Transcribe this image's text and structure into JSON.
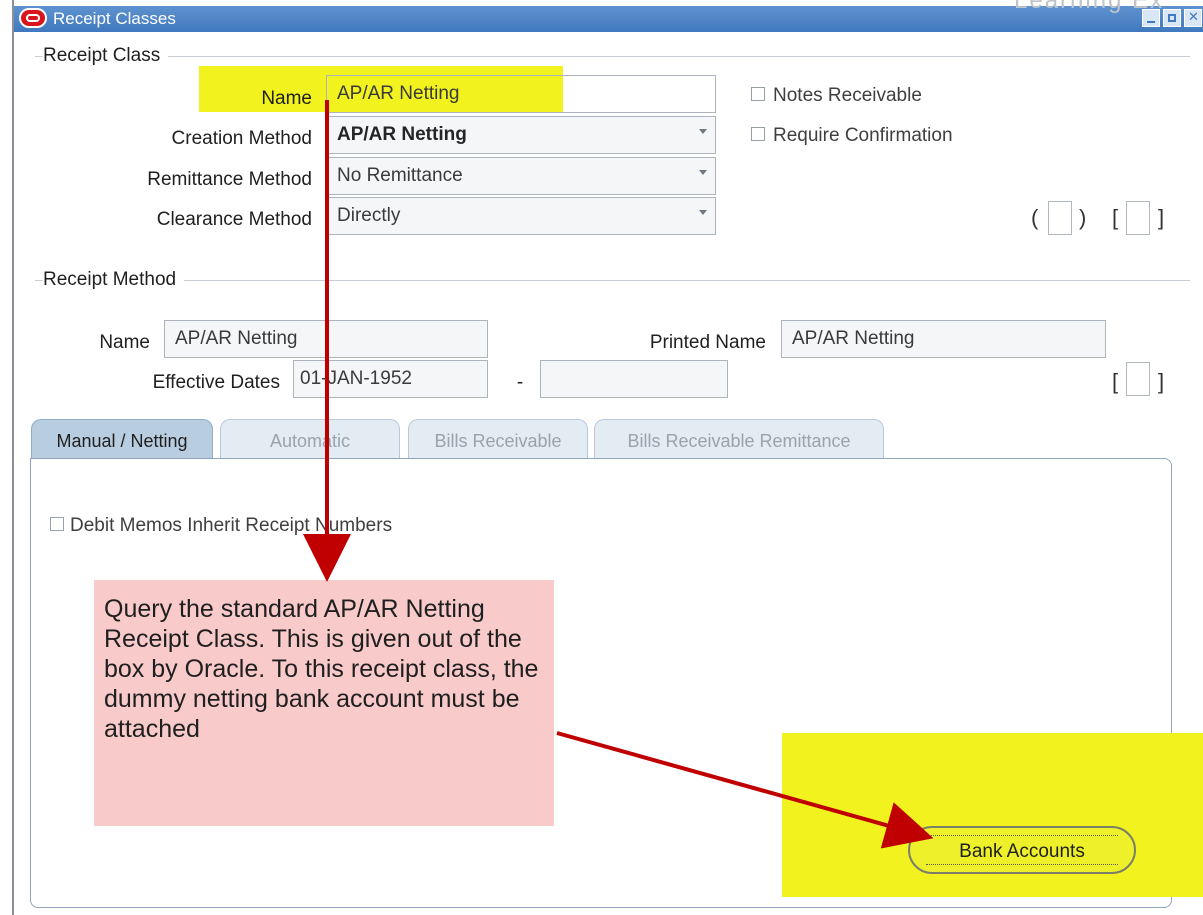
{
  "window": {
    "title": "Receipt Classes",
    "corner_text": "Learning Ex"
  },
  "receipt_class": {
    "section_title": "Receipt Class",
    "name_label": "Name",
    "name_value": "AP/AR Netting",
    "creation_method_label": "Creation Method",
    "creation_method_value": "AP/AR Netting",
    "remittance_method_label": "Remittance Method",
    "remittance_method_value": "No Remittance",
    "clearance_method_label": "Clearance Method",
    "clearance_method_value": "Directly",
    "notes_receivable_label": "Notes Receivable",
    "require_confirmation_label": "Require Confirmation"
  },
  "receipt_method": {
    "section_title": "Receipt Method",
    "name_label": "Name",
    "name_value": "AP/AR Netting",
    "printed_name_label": "Printed Name",
    "printed_name_value": "AP/AR Netting",
    "effective_dates_label": "Effective Dates",
    "effective_from_value": "01-JAN-1952",
    "effective_to_value": "",
    "date_separator": "-"
  },
  "tabs": [
    {
      "label": "Manual / Netting",
      "active": true
    },
    {
      "label": "Automatic",
      "active": false
    },
    {
      "label": "Bills Receivable",
      "active": false
    },
    {
      "label": "Bills Receivable Remittance",
      "active": false
    }
  ],
  "panel": {
    "debit_memos_label": "Debit Memos Inherit Receipt Numbers",
    "bank_accounts_button": "Bank Accounts"
  },
  "annotation": {
    "text": "Query the standard AP/AR Netting Receipt Class. This is given out of the box by Oracle. To this receipt class, the dummy netting bank account must be attached"
  },
  "colors": {
    "titlebar": "#3f79bf",
    "highlight": "#f1f21e",
    "note_background": "#f8caca",
    "arrow": "#c00000"
  }
}
